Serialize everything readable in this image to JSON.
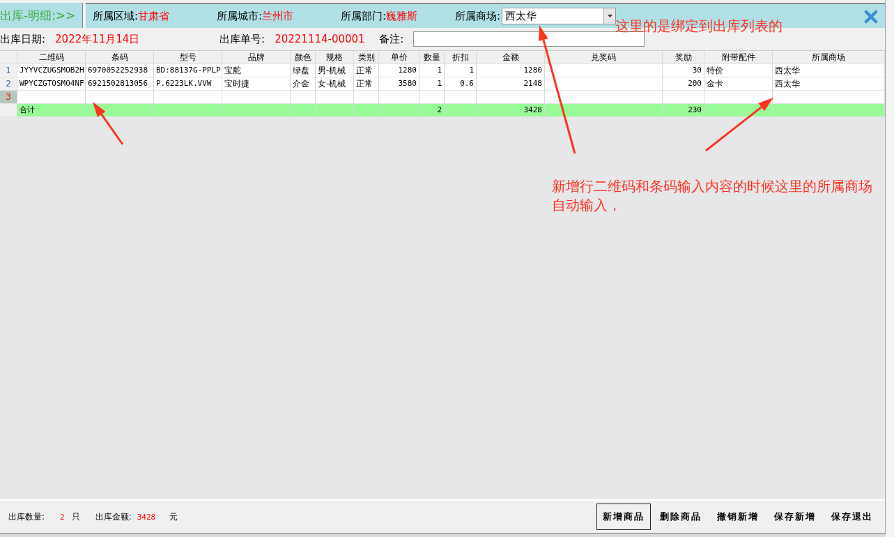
{
  "header": {
    "title": "出库-明细:>>",
    "fields": [
      {
        "label": "所属区域:",
        "value": "甘肃省"
      },
      {
        "label": "所属城市:",
        "value": "兰州市"
      },
      {
        "label": "所属部门:",
        "value": "巍雅斯"
      }
    ],
    "mall": {
      "label": "所属商场:",
      "value": "西太华"
    }
  },
  "info": {
    "date_label": "出库日期:",
    "date": "2022年11月14日",
    "number_label": "出库单号:",
    "number": "20221114-00001",
    "note_label": "备注:"
  },
  "table": {
    "columns": [
      {
        "label": "二维码",
        "kind": "text"
      },
      {
        "label": "条码",
        "kind": "text"
      },
      {
        "label": "型号",
        "kind": "text"
      },
      {
        "label": "品牌",
        "kind": "text"
      },
      {
        "label": "颜色",
        "kind": "text"
      },
      {
        "label": "规格",
        "kind": "text"
      },
      {
        "label": "类别",
        "kind": "text"
      },
      {
        "label": "单价",
        "kind": "number"
      },
      {
        "label": "数量",
        "kind": "number"
      },
      {
        "label": "折扣",
        "kind": "number"
      },
      {
        "label": "金额",
        "kind": "number"
      },
      {
        "label": "兑奖码",
        "kind": "text"
      },
      {
        "label": "奖励",
        "kind": "number"
      },
      {
        "label": "附带配件",
        "kind": "text"
      },
      {
        "label": "所属商场",
        "kind": "text"
      }
    ],
    "rows": [
      {
        "number": "1",
        "selected": false,
        "cells": [
          "JYYVCZUGSMOB2H",
          "6970052252938",
          "BD:88137G-PPLP",
          "宝舵",
          "绿盘",
          "男-机械",
          "正常",
          "1280",
          "1",
          "1",
          "1280",
          null,
          "30",
          "特价",
          "西太华"
        ]
      },
      {
        "number": "2",
        "selected": false,
        "cells": [
          "WPYCZGTOSMO4NF",
          "6921502813056",
          "P.6223LK.VVW",
          "宝时捷",
          "介金",
          "女-机械",
          "正常",
          "3580",
          "1",
          "0.6",
          "2148",
          null,
          "200",
          "金卡",
          "西太华"
        ]
      },
      {
        "number": "3",
        "selected": true,
        "cells": []
      }
    ],
    "total": {
      "cells": [
        "合计",
        null,
        null,
        null,
        null,
        null,
        null,
        null,
        "2",
        null,
        "3428",
        null,
        "230",
        null,
        null
      ]
    }
  },
  "footer": {
    "quantity_label": "出库数量:",
    "quantity": "2",
    "quantity_unit": "只",
    "amount_label": "出库金额:",
    "amount": "3428",
    "amount_unit": "元",
    "buttons": [
      {
        "label": "新增商品",
        "selected": true
      },
      {
        "label": "删除商品",
        "selected": false
      },
      {
        "label": "撤销新增",
        "selected": false
      },
      {
        "label": "保存新增",
        "selected": false
      },
      {
        "label": "保存退出",
        "selected": false
      }
    ]
  },
  "annotations": [
    "这里的是绑定到出库列表的",
    "新增行二维码和条码输入内容的时候这里的所属商场自动输入，"
  ]
}
